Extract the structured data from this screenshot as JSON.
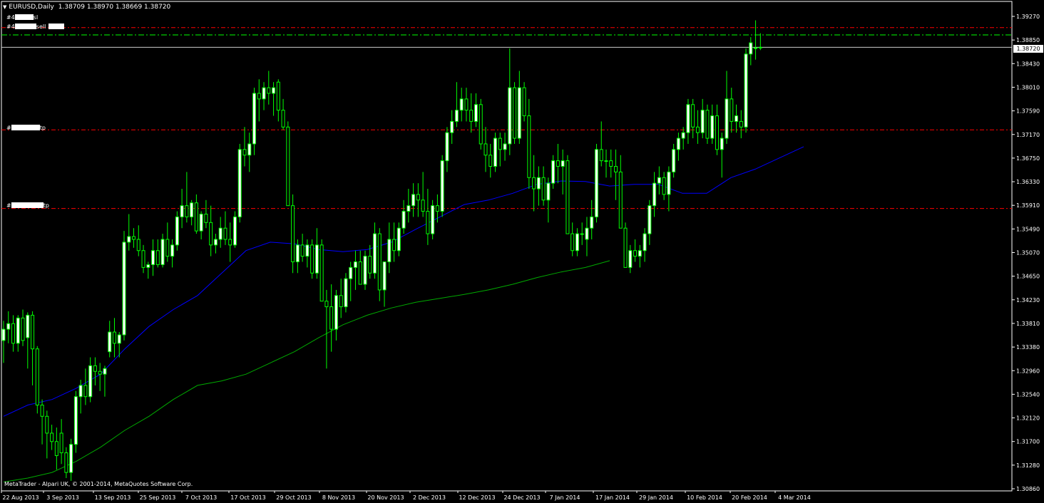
{
  "window": {
    "symbol_label": "EURUSD,Daily",
    "ohlc": "1.38709 1.38970 1.38669 1.38720",
    "copyright": "MetaTrader - Alpari UK, © 2001-2014, MetaQuotes Software Corp.",
    "current_price": "1.38720",
    "dropdown_icon": "triangle-down-icon"
  },
  "order_lines": [
    {
      "label_prefix": "#4",
      "label_suffix": "sl",
      "price": 1.3907,
      "style": "dash-dot",
      "color": "#ff0000"
    },
    {
      "label_prefix": "#4",
      "label_suffix": "sell",
      "price": 1.3894,
      "style": "dash-dot",
      "color": "#00ff00"
    },
    {
      "label_prefix": "#",
      "label_suffix": "tp",
      "price": 1.3725,
      "style": "dash-dot",
      "color": "#ff0000"
    },
    {
      "label_prefix": "#",
      "label_suffix": "tp",
      "price": 1.3585,
      "style": "dash-dot",
      "color": "#ff0000"
    }
  ],
  "colors": {
    "background": "#000000",
    "bull_candle": "#ffffff",
    "bear_candle": "#000000",
    "wick": "#00ff00",
    "ma_fast": "#0000ff",
    "ma_slow": "#00aa00",
    "axis_text": "#ffffff"
  },
  "chart_data": {
    "type": "candlestick",
    "y_ticks": [
      "1.39270",
      "1.38850",
      "1.38430",
      "1.38010",
      "1.37590",
      "1.37170",
      "1.36750",
      "1.36330",
      "1.35910",
      "1.35490",
      "1.35070",
      "1.34650",
      "1.34230",
      "1.33810",
      "1.33380",
      "1.32960",
      "1.32540",
      "1.32120",
      "1.31700",
      "1.31280",
      "1.30860"
    ],
    "x_ticks": [
      "22 Aug 2013",
      "3 Sep 2013",
      "13 Sep 2013",
      "25 Sep 2013",
      "7 Oct 2013",
      "17 Oct 2013",
      "29 Oct 2013",
      "8 Nov 2013",
      "20 Nov 2013",
      "2 Dec 2013",
      "12 Dec 2013",
      "24 Dec 2013",
      "7 Jan 2014",
      "17 Jan 2014",
      "29 Jan 2014",
      "10 Feb 2014",
      "20 Feb 2014",
      "4 Mar 2014"
    ],
    "ylim": [
      1.3086,
      1.395
    ],
    "candles": [
      [
        1.335,
        1.3385,
        1.331,
        1.337
      ],
      [
        1.337,
        1.3402,
        1.3345,
        1.338
      ],
      [
        1.338,
        1.3395,
        1.333,
        1.3345
      ],
      [
        1.3345,
        1.3395,
        1.333,
        1.339
      ],
      [
        1.339,
        1.3405,
        1.334,
        1.335
      ],
      [
        1.3355,
        1.34,
        1.33,
        1.3395
      ],
      [
        1.3395,
        1.3402,
        1.327,
        1.3335
      ],
      [
        1.3335,
        1.334,
        1.322,
        1.3235
      ],
      [
        1.3235,
        1.3245,
        1.3165,
        1.3215
      ],
      [
        1.3215,
        1.3225,
        1.314,
        1.3185
      ],
      [
        1.3185,
        1.32,
        1.3155,
        1.317
      ],
      [
        1.317,
        1.3195,
        1.312,
        1.3145
      ],
      [
        1.3185,
        1.321,
        1.313,
        1.315
      ],
      [
        1.315,
        1.316,
        1.3105,
        1.3115
      ],
      [
        1.3115,
        1.3175,
        1.31,
        1.3165
      ],
      [
        1.3165,
        1.326,
        1.315,
        1.325
      ],
      [
        1.325,
        1.328,
        1.322,
        1.327
      ],
      [
        1.327,
        1.33,
        1.3235,
        1.325
      ],
      [
        1.325,
        1.332,
        1.324,
        1.3305
      ],
      [
        1.3305,
        1.332,
        1.327,
        1.3295
      ],
      [
        1.3295,
        1.331,
        1.326,
        1.329
      ],
      [
        1.329,
        1.3305,
        1.325,
        1.33
      ],
      [
        1.333,
        1.3385,
        1.332,
        1.3365
      ],
      [
        1.3365,
        1.339,
        1.332,
        1.3345
      ],
      [
        1.3345,
        1.3365,
        1.332,
        1.336
      ],
      [
        1.336,
        1.3545,
        1.335,
        1.3525
      ],
      [
        1.3525,
        1.3575,
        1.351,
        1.3535
      ],
      [
        1.3535,
        1.355,
        1.3515,
        1.353
      ],
      [
        1.353,
        1.3555,
        1.35,
        1.351
      ],
      [
        1.351,
        1.352,
        1.347,
        1.348
      ],
      [
        1.348,
        1.349,
        1.346,
        1.3485
      ],
      [
        1.3485,
        1.353,
        1.3465,
        1.351
      ],
      [
        1.351,
        1.353,
        1.348,
        1.3485
      ],
      [
        1.3485,
        1.354,
        1.348,
        1.353
      ],
      [
        1.353,
        1.356,
        1.349,
        1.35
      ],
      [
        1.35,
        1.353,
        1.348,
        1.352
      ],
      [
        1.352,
        1.358,
        1.351,
        1.357
      ],
      [
        1.357,
        1.362,
        1.355,
        1.359
      ],
      [
        1.359,
        1.365,
        1.356,
        1.357
      ],
      [
        1.357,
        1.36,
        1.3555,
        1.3595
      ],
      [
        1.3595,
        1.361,
        1.354,
        1.3545
      ],
      [
        1.3545,
        1.358,
        1.353,
        1.3575
      ],
      [
        1.3575,
        1.36,
        1.355,
        1.356
      ],
      [
        1.356,
        1.359,
        1.35,
        1.352
      ],
      [
        1.352,
        1.354,
        1.3505,
        1.353
      ],
      [
        1.353,
        1.357,
        1.3515,
        1.355
      ],
      [
        1.355,
        1.358,
        1.352,
        1.353
      ],
      [
        1.353,
        1.356,
        1.349,
        1.352
      ],
      [
        1.352,
        1.358,
        1.3515,
        1.357
      ],
      [
        1.357,
        1.37,
        1.356,
        1.369
      ],
      [
        1.369,
        1.373,
        1.366,
        1.368
      ],
      [
        1.368,
        1.372,
        1.365,
        1.37
      ],
      [
        1.37,
        1.38,
        1.368,
        1.379
      ],
      [
        1.379,
        1.3815,
        1.374,
        1.378
      ],
      [
        1.378,
        1.381,
        1.376,
        1.38
      ],
      [
        1.38,
        1.383,
        1.377,
        1.379
      ],
      [
        1.379,
        1.381,
        1.375,
        1.38
      ],
      [
        1.381,
        1.3815,
        1.374,
        1.376
      ],
      [
        1.376,
        1.378,
        1.3725,
        1.373
      ],
      [
        1.373,
        1.374,
        1.367,
        1.359
      ],
      [
        1.359,
        1.361,
        1.347,
        1.349
      ],
      [
        1.349,
        1.353,
        1.347,
        1.352
      ],
      [
        1.352,
        1.354,
        1.349,
        1.35
      ],
      [
        1.35,
        1.353,
        1.348,
        1.352
      ],
      [
        1.352,
        1.353,
        1.346,
        1.347
      ],
      [
        1.347,
        1.355,
        1.346,
        1.352
      ],
      [
        1.352,
        1.353,
        1.343,
        1.342
      ],
      [
        1.342,
        1.344,
        1.33,
        1.341
      ],
      [
        1.341,
        1.345,
        1.333,
        1.337
      ],
      [
        1.337,
        1.344,
        1.335,
        1.343
      ],
      [
        1.343,
        1.346,
        1.339,
        1.341
      ],
      [
        1.341,
        1.347,
        1.34,
        1.346
      ],
      [
        1.346,
        1.349,
        1.342,
        1.348
      ],
      [
        1.348,
        1.351,
        1.344,
        1.349
      ],
      [
        1.349,
        1.351,
        1.345,
        1.345
      ],
      [
        1.345,
        1.351,
        1.344,
        1.35
      ],
      [
        1.35,
        1.352,
        1.346,
        1.347
      ],
      [
        1.347,
        1.356,
        1.346,
        1.354
      ],
      [
        1.354,
        1.355,
        1.342,
        1.344
      ],
      [
        1.344,
        1.349,
        1.341,
        1.349
      ],
      [
        1.349,
        1.356,
        1.347,
        1.353
      ],
      [
        1.353,
        1.356,
        1.349,
        1.351
      ],
      [
        1.351,
        1.356,
        1.35,
        1.355
      ],
      [
        1.355,
        1.36,
        1.354,
        1.358
      ],
      [
        1.358,
        1.362,
        1.356,
        1.359
      ],
      [
        1.359,
        1.363,
        1.357,
        1.361
      ],
      [
        1.361,
        1.363,
        1.357,
        1.36
      ],
      [
        1.36,
        1.365,
        1.357,
        1.358
      ],
      [
        1.358,
        1.362,
        1.352,
        1.354
      ],
      [
        1.354,
        1.36,
        1.353,
        1.359
      ],
      [
        1.359,
        1.361,
        1.356,
        1.358
      ],
      [
        1.358,
        1.368,
        1.357,
        1.367
      ],
      [
        1.367,
        1.373,
        1.365,
        1.372
      ],
      [
        1.372,
        1.376,
        1.37,
        1.374
      ],
      [
        1.374,
        1.381,
        1.373,
        1.376
      ],
      [
        1.376,
        1.38,
        1.374,
        1.378
      ],
      [
        1.378,
        1.38,
        1.374,
        1.376
      ],
      [
        1.376,
        1.379,
        1.372,
        1.374
      ],
      [
        1.374,
        1.379,
        1.373,
        1.377
      ],
      [
        1.377,
        1.378,
        1.369,
        1.37
      ],
      [
        1.37,
        1.373,
        1.365,
        1.368
      ],
      [
        1.368,
        1.37,
        1.364,
        1.366
      ],
      [
        1.366,
        1.372,
        1.365,
        1.371
      ],
      [
        1.371,
        1.372,
        1.366,
        1.369
      ],
      [
        1.369,
        1.372,
        1.367,
        1.37
      ],
      [
        1.37,
        1.387,
        1.368,
        1.38
      ],
      [
        1.38,
        1.381,
        1.37,
        1.371
      ],
      [
        1.371,
        1.383,
        1.37,
        1.38
      ],
      [
        1.38,
        1.381,
        1.374,
        1.375
      ],
      [
        1.375,
        1.378,
        1.362,
        1.364
      ],
      [
        1.364,
        1.368,
        1.358,
        1.362
      ],
      [
        1.362,
        1.366,
        1.359,
        1.364
      ],
      [
        1.364,
        1.366,
        1.359,
        1.36
      ],
      [
        1.36,
        1.364,
        1.356,
        1.363
      ],
      [
        1.363,
        1.368,
        1.362,
        1.367
      ],
      [
        1.367,
        1.37,
        1.363,
        1.366
      ],
      [
        1.366,
        1.369,
        1.361,
        1.367
      ],
      [
        1.367,
        1.368,
        1.354,
        1.354
      ],
      [
        1.354,
        1.356,
        1.35,
        1.351
      ],
      [
        1.351,
        1.355,
        1.35,
        1.354
      ],
      [
        1.354,
        1.356,
        1.352,
        1.354
      ],
      [
        1.353,
        1.357,
        1.35,
        1.355
      ],
      [
        1.355,
        1.36,
        1.353,
        1.357
      ],
      [
        1.357,
        1.37,
        1.356,
        1.369
      ],
      [
        1.369,
        1.374,
        1.366,
        1.367
      ],
      [
        1.367,
        1.369,
        1.364,
        1.367
      ],
      [
        1.367,
        1.369,
        1.364,
        1.366
      ],
      [
        1.366,
        1.369,
        1.36,
        1.365
      ],
      [
        1.365,
        1.368,
        1.355,
        1.355
      ],
      [
        1.355,
        1.356,
        1.348,
        1.348
      ],
      [
        1.348,
        1.352,
        1.347,
        1.351
      ],
      [
        1.351,
        1.353,
        1.349,
        1.35
      ],
      [
        1.35,
        1.352,
        1.348,
        1.351
      ],
      [
        1.351,
        1.355,
        1.349,
        1.354
      ],
      [
        1.354,
        1.36,
        1.352,
        1.359
      ],
      [
        1.359,
        1.365,
        1.357,
        1.363
      ],
      [
        1.363,
        1.366,
        1.361,
        1.364
      ],
      [
        1.364,
        1.365,
        1.36,
        1.361
      ],
      [
        1.361,
        1.366,
        1.358,
        1.365
      ],
      [
        1.365,
        1.37,
        1.364,
        1.369
      ],
      [
        1.369,
        1.372,
        1.367,
        1.371
      ],
      [
        1.371,
        1.373,
        1.369,
        1.372
      ],
      [
        1.372,
        1.378,
        1.37,
        1.377
      ],
      [
        1.377,
        1.378,
        1.371,
        1.373
      ],
      [
        1.373,
        1.376,
        1.37,
        1.372
      ],
      [
        1.372,
        1.378,
        1.371,
        1.376
      ],
      [
        1.376,
        1.377,
        1.37,
        1.371
      ],
      [
        1.371,
        1.377,
        1.37,
        1.375
      ],
      [
        1.375,
        1.377,
        1.368,
        1.369
      ],
      [
        1.369,
        1.372,
        1.364,
        1.371
      ],
      [
        1.371,
        1.383,
        1.37,
        1.378
      ],
      [
        1.378,
        1.38,
        1.372,
        1.374
      ],
      [
        1.374,
        1.377,
        1.372,
        1.375
      ],
      [
        1.374,
        1.376,
        1.371,
        1.373
      ],
      [
        1.373,
        1.387,
        1.372,
        1.386
      ],
      [
        1.386,
        1.389,
        1.384,
        1.388
      ],
      [
        1.387,
        1.392,
        1.385,
        1.3871
      ],
      [
        1.3871,
        1.3897,
        1.3867,
        1.3872
      ]
    ],
    "ma_fast": [
      [
        0,
        1.3215
      ],
      [
        10,
        1.3235
      ],
      [
        20,
        1.3245
      ],
      [
        30,
        1.3265
      ],
      [
        40,
        1.329
      ],
      [
        50,
        1.3335
      ],
      [
        60,
        1.3375
      ],
      [
        70,
        1.3405
      ],
      [
        80,
        1.343
      ],
      [
        90,
        1.347
      ],
      [
        100,
        1.351
      ],
      [
        110,
        1.3525
      ],
      [
        120,
        1.3522
      ],
      [
        130,
        1.3512
      ],
      [
        140,
        1.3508
      ],
      [
        150,
        1.3512
      ],
      [
        160,
        1.3525
      ],
      [
        170,
        1.3548
      ],
      [
        180,
        1.357
      ],
      [
        190,
        1.3592
      ],
      [
        200,
        1.36
      ],
      [
        210,
        1.3612
      ],
      [
        220,
        1.3628
      ],
      [
        230,
        1.3634
      ],
      [
        240,
        1.3633
      ],
      [
        250,
        1.3625
      ],
      [
        260,
        1.3628
      ],
      [
        270,
        1.3628
      ],
      [
        280,
        1.3612
      ],
      [
        290,
        1.3612
      ],
      [
        300,
        1.364
      ],
      [
        310,
        1.3655
      ],
      [
        320,
        1.3675
      ],
      [
        330,
        1.3695
      ]
    ],
    "ma_slow": [
      [
        0,
        1.3098
      ],
      [
        10,
        1.3105
      ],
      [
        20,
        1.3115
      ],
      [
        30,
        1.3135
      ],
      [
        40,
        1.316
      ],
      [
        50,
        1.319
      ],
      [
        60,
        1.3215
      ],
      [
        70,
        1.3245
      ],
      [
        80,
        1.327
      ],
      [
        90,
        1.3278
      ],
      [
        100,
        1.329
      ],
      [
        110,
        1.331
      ],
      [
        120,
        1.333
      ],
      [
        130,
        1.3355
      ],
      [
        140,
        1.3378
      ],
      [
        150,
        1.3395
      ],
      [
        160,
        1.3408
      ],
      [
        170,
        1.3418
      ],
      [
        180,
        1.3425
      ],
      [
        190,
        1.3432
      ],
      [
        200,
        1.344
      ],
      [
        210,
        1.345
      ],
      [
        220,
        1.3462
      ],
      [
        230,
        1.3472
      ],
      [
        240,
        1.348
      ],
      [
        250,
        1.3492
      ]
    ]
  }
}
